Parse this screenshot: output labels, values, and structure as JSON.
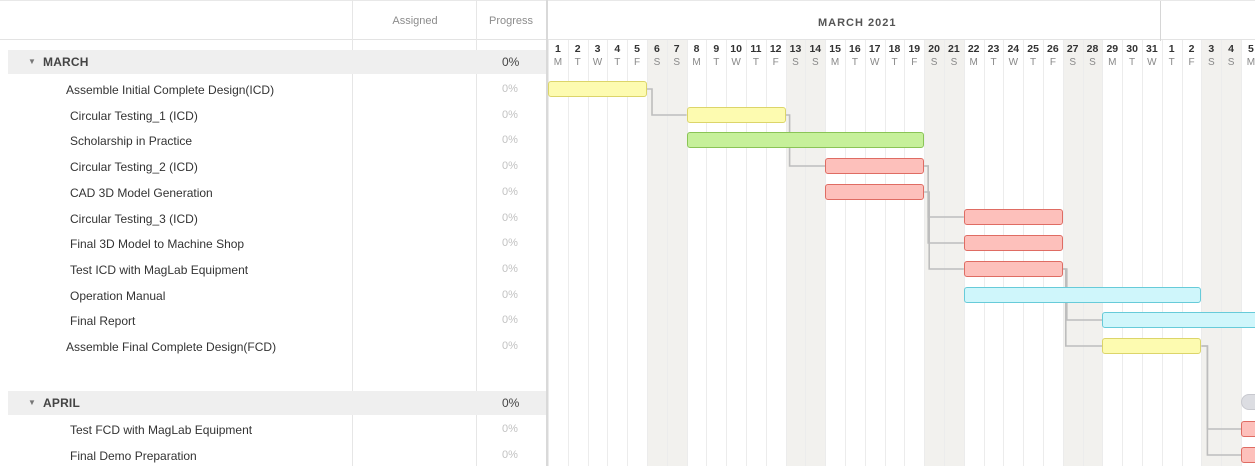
{
  "columns": {
    "assigned": "Assigned",
    "progress": "Progress"
  },
  "groups": [
    {
      "label": "MARCH",
      "progress": "0%",
      "arrow": "▼"
    },
    {
      "label": "APRIL",
      "progress": "0%",
      "arrow": "▼"
    }
  ],
  "tasks": [
    {
      "name": "Assemble Initial Complete Design(ICD)",
      "progress": "0%"
    },
    {
      "name": "Circular Testing_1 (ICD)",
      "progress": "0%"
    },
    {
      "name": "Scholarship in Practice",
      "progress": "0%"
    },
    {
      "name": "Circular Testing_2 (ICD)",
      "progress": "0%"
    },
    {
      "name": "CAD 3D Model Generation",
      "progress": "0%"
    },
    {
      "name": "Circular Testing_3 (ICD)",
      "progress": "0%"
    },
    {
      "name": "Final 3D Model to Machine Shop",
      "progress": "0%"
    },
    {
      "name": "Test ICD with MagLab Equipment",
      "progress": "0%"
    },
    {
      "name": "Operation Manual",
      "progress": "0%"
    },
    {
      "name": "Final Report",
      "progress": "0%"
    },
    {
      "name": "Assemble Final Complete Design(FCD)",
      "progress": "0%"
    },
    {
      "name": "Test FCD with MagLab Equipment",
      "progress": "0%"
    },
    {
      "name": "Final Demo Preparation",
      "progress": "0%"
    }
  ],
  "timeline": {
    "month_label": "MARCH 2021",
    "days": [
      {
        "n": "1",
        "d": "M"
      },
      {
        "n": "2",
        "d": "T"
      },
      {
        "n": "3",
        "d": "W"
      },
      {
        "n": "4",
        "d": "T"
      },
      {
        "n": "5",
        "d": "F"
      },
      {
        "n": "6",
        "d": "S"
      },
      {
        "n": "7",
        "d": "S"
      },
      {
        "n": "8",
        "d": "M"
      },
      {
        "n": "9",
        "d": "T"
      },
      {
        "n": "10",
        "d": "W"
      },
      {
        "n": "11",
        "d": "T"
      },
      {
        "n": "12",
        "d": "F"
      },
      {
        "n": "13",
        "d": "S"
      },
      {
        "n": "14",
        "d": "S"
      },
      {
        "n": "15",
        "d": "M"
      },
      {
        "n": "16",
        "d": "T"
      },
      {
        "n": "17",
        "d": "W"
      },
      {
        "n": "18",
        "d": "T"
      },
      {
        "n": "19",
        "d": "F"
      },
      {
        "n": "20",
        "d": "S"
      },
      {
        "n": "21",
        "d": "S"
      },
      {
        "n": "22",
        "d": "M"
      },
      {
        "n": "23",
        "d": "T"
      },
      {
        "n": "24",
        "d": "W"
      },
      {
        "n": "25",
        "d": "T"
      },
      {
        "n": "26",
        "d": "F"
      },
      {
        "n": "27",
        "d": "S"
      },
      {
        "n": "28",
        "d": "S"
      },
      {
        "n": "29",
        "d": "M"
      },
      {
        "n": "30",
        "d": "T"
      },
      {
        "n": "31",
        "d": "W"
      },
      {
        "n": "1",
        "d": "T"
      },
      {
        "n": "2",
        "d": "F"
      },
      {
        "n": "3",
        "d": "S"
      },
      {
        "n": "4",
        "d": "S"
      },
      {
        "n": "5",
        "d": "M"
      }
    ],
    "bar_colors": {
      "yellow": "#fdfbb0",
      "green": "#c6f09a",
      "red": "#fdc0bb",
      "cyan": "#cff6fb",
      "grey": "#dcdde2"
    },
    "bars": [
      {
        "task": 0,
        "start": 1,
        "end": 5,
        "color": "yellow"
      },
      {
        "task": 1,
        "start": 8,
        "end": 12,
        "color": "yellow"
      },
      {
        "task": 2,
        "start": 8,
        "end": 19,
        "color": "green"
      },
      {
        "task": 3,
        "start": 15,
        "end": 19,
        "color": "red"
      },
      {
        "task": 4,
        "start": 15,
        "end": 19,
        "color": "red"
      },
      {
        "task": 5,
        "start": 22,
        "end": 26,
        "color": "red"
      },
      {
        "task": 6,
        "start": 22,
        "end": 26,
        "color": "red"
      },
      {
        "task": 7,
        "start": 22,
        "end": 26,
        "color": "red"
      },
      {
        "task": 8,
        "start": 22,
        "end": 33,
        "color": "cyan"
      },
      {
        "task": 9,
        "start": 29,
        "end": 36,
        "color": "cyan"
      },
      {
        "task": 10,
        "start": 29,
        "end": 33,
        "color": "yellow"
      },
      {
        "task": 11,
        "start": 36,
        "end": 36,
        "color": "red"
      },
      {
        "task": 12,
        "start": 36,
        "end": 36,
        "color": "red"
      },
      {
        "task": "april-summary",
        "start": 36,
        "end": 36,
        "color": "grey"
      }
    ]
  }
}
